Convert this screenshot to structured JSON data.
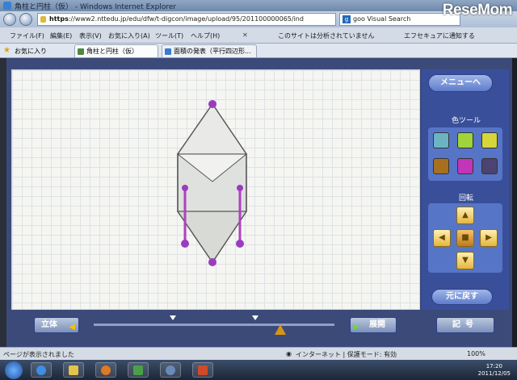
{
  "window": {
    "title": "角柱と円柱（仮） - Windows Internet Explorer"
  },
  "address": {
    "scheme": "https",
    "url_rest": "://www2.nttedu.jp/edu/dfw/t-digcon/image/upload/95/201100000065/ind"
  },
  "search": {
    "value": "goo Visual Search"
  },
  "logo": {
    "text": "ReseMom"
  },
  "menu": {
    "file": "ファイル(F)",
    "edit": "編集(E)",
    "view": "表示(V)",
    "favorites": "お気に入り(A)",
    "tools": "ツール(T)",
    "help": "ヘルプ(H)",
    "security_msg": "このサイトは分析されていません",
    "notify": "エフセキュアに通知する"
  },
  "favbar": {
    "favorites": "お気に入り"
  },
  "tabs": [
    {
      "label": "角柱と円柱（仮）"
    },
    {
      "label": "面積の発表（平行四辺形..."
    }
  ],
  "app": {
    "menu_button": "メニューへ",
    "color_tool": "色ツール",
    "rotate": "回転",
    "reset": "元に戻す",
    "solid": "立体",
    "unfold": "展開",
    "memo": "記号",
    "colors": [
      "#6bb5c2",
      "#9fd43a",
      "#d6d63a",
      "#a8701e",
      "#c235b8",
      "#4b4470"
    ]
  },
  "status": {
    "left": "ページが表示されました",
    "zone": "インターネット | 保護モード: 有効",
    "zoom": "100%"
  },
  "clock": {
    "time": "17:20",
    "date": "2011/12/05"
  }
}
